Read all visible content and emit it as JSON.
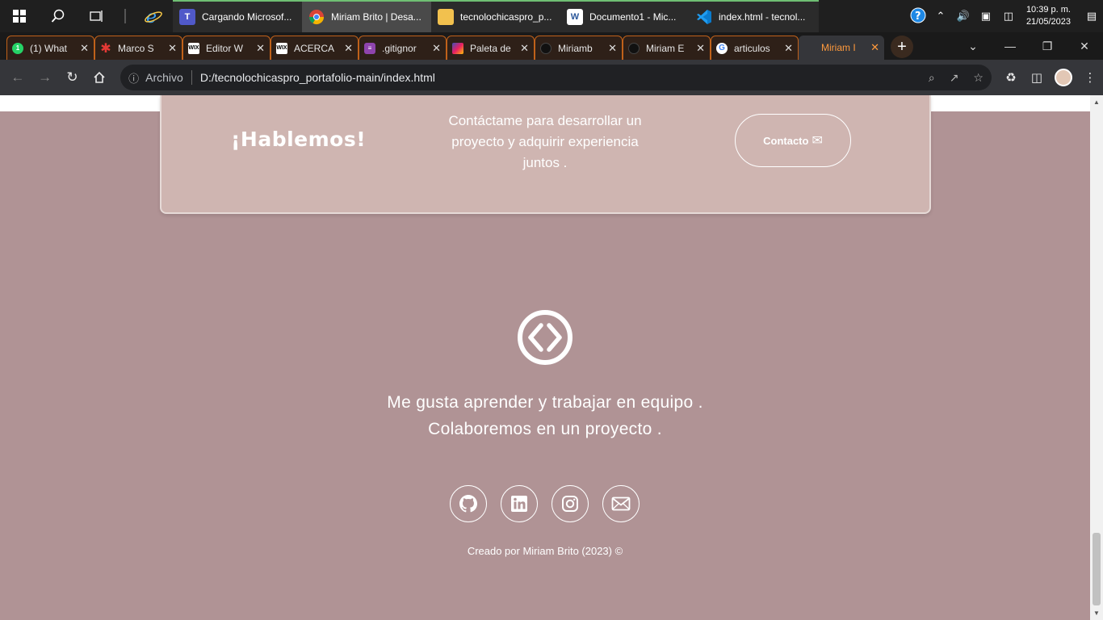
{
  "taskbar": {
    "apps": [
      {
        "label": "Cargando Microsof...",
        "icon": "teams-icon"
      },
      {
        "label": "Miriam Brito | Desa...",
        "icon": "chrome-icon"
      },
      {
        "label": "tecnolochicaspro_p...",
        "icon": "folder-icon"
      },
      {
        "label": "Documento1 - Mic...",
        "icon": "word-icon"
      },
      {
        "label": "index.html - tecnol...",
        "icon": "vscode-icon"
      }
    ],
    "clock_time": "10:39 p. m.",
    "clock_date": "21/05/2023"
  },
  "tabs": [
    {
      "label": "(1) What",
      "icon": "whatsapp-icon",
      "color": "#25d366"
    },
    {
      "label": "Marco S",
      "icon": "asterisk-icon",
      "color": "#e53935"
    },
    {
      "label": "Editor W",
      "icon": "wix-icon",
      "color": "#000000"
    },
    {
      "label": "ACERCA",
      "icon": "wix-icon",
      "color": "#000000"
    },
    {
      "label": ".gitignor",
      "icon": "stack-icon",
      "color": "#8e44ad"
    },
    {
      "label": "Paleta de",
      "icon": "palette-icon",
      "color": "#3f51b5"
    },
    {
      "label": "Miriamb",
      "icon": "github-icon",
      "color": "#222222"
    },
    {
      "label": "Miriam E",
      "icon": "github-icon",
      "color": "#222222"
    },
    {
      "label": "articulos",
      "icon": "google-icon",
      "color": "#4285f4"
    },
    {
      "label": "Miriam I",
      "icon": "page-icon",
      "color": "#b09395"
    }
  ],
  "address": {
    "scheme_label": "Archivo",
    "url": "D:/tecnolochicaspro_portafolio-main/index.html"
  },
  "page": {
    "cta": {
      "title": "¡Hablemos!",
      "text": "Contáctame para desarrollar un proyecto y adquirir experiencia juntos .",
      "button": "Contacto"
    },
    "tagline_1": "Me gusta aprender y trabajar en equipo .",
    "tagline_2": "Colaboremos en un proyecto .",
    "socials": [
      "github-icon",
      "linkedin-icon",
      "instagram-icon",
      "mail-icon"
    ],
    "credit": "Creado por Miriam Brito (2023) ©"
  },
  "colors": {
    "page_bg": "#b09395",
    "cta_bg": "#cfb5b1",
    "tab_border": "#c0611a",
    "active_tab_text": "#ff9a3c"
  }
}
